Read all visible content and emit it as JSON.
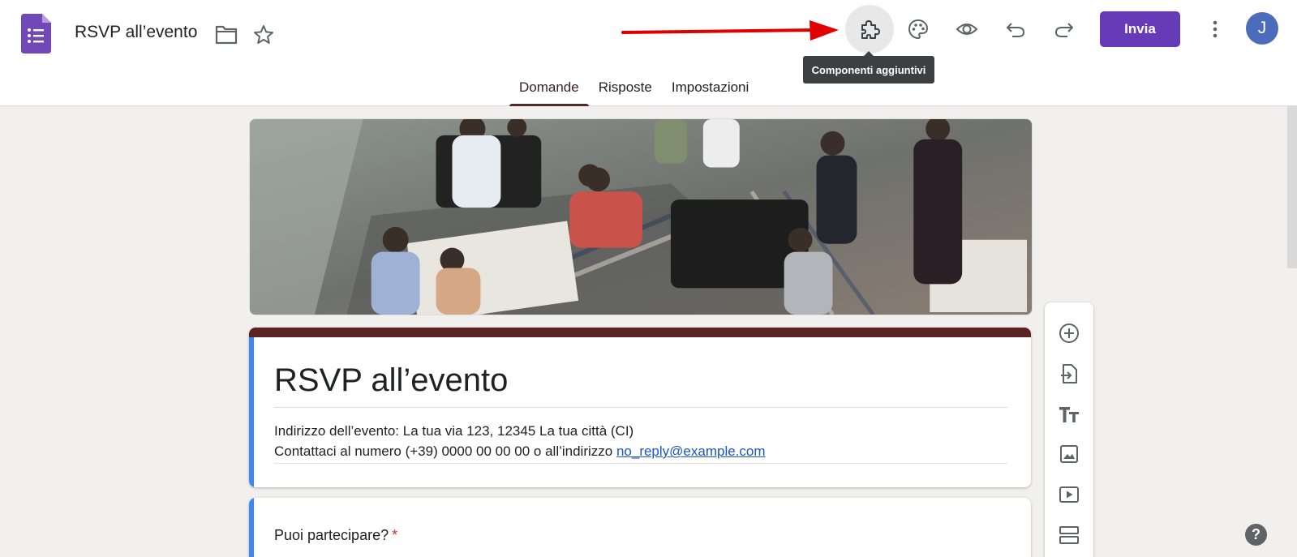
{
  "header": {
    "doc_title": "RSVP all’evento",
    "send_label": "Invia",
    "avatar_initial": "J",
    "tooltip": "Componenti aggiuntivi",
    "icons": [
      "forms-logo-icon",
      "folder-icon",
      "star-icon",
      "puzzle-icon",
      "palette-icon",
      "eye-icon",
      "undo-icon",
      "redo-icon",
      "more-vert-icon"
    ]
  },
  "tabs": [
    {
      "label": "Domande",
      "active": true
    },
    {
      "label": "Risposte",
      "active": false
    },
    {
      "label": "Impostazioni",
      "active": false
    }
  ],
  "form": {
    "title": "RSVP all’evento",
    "description_line1": "Indirizzo dell’evento: La tua via 123, 12345 La tua città (CI)",
    "description_line2_prefix": "Contattaci al numero (+39) 0000 00 00 00 o all’indirizzo ",
    "email": "no_reply@example.com"
  },
  "question": {
    "title": "Puoi partecipare?",
    "required_mark": "*"
  },
  "side_toolbar": [
    "add-question-icon",
    "import-questions-icon",
    "add-title-icon",
    "add-image-icon",
    "add-video-icon",
    "add-section-icon"
  ],
  "help_label": "?",
  "colors": {
    "accent": "#673ab7",
    "theme": "#5b2323",
    "focus_bar": "#4285f4",
    "required": "#d93025",
    "arrow": "#e00000"
  }
}
